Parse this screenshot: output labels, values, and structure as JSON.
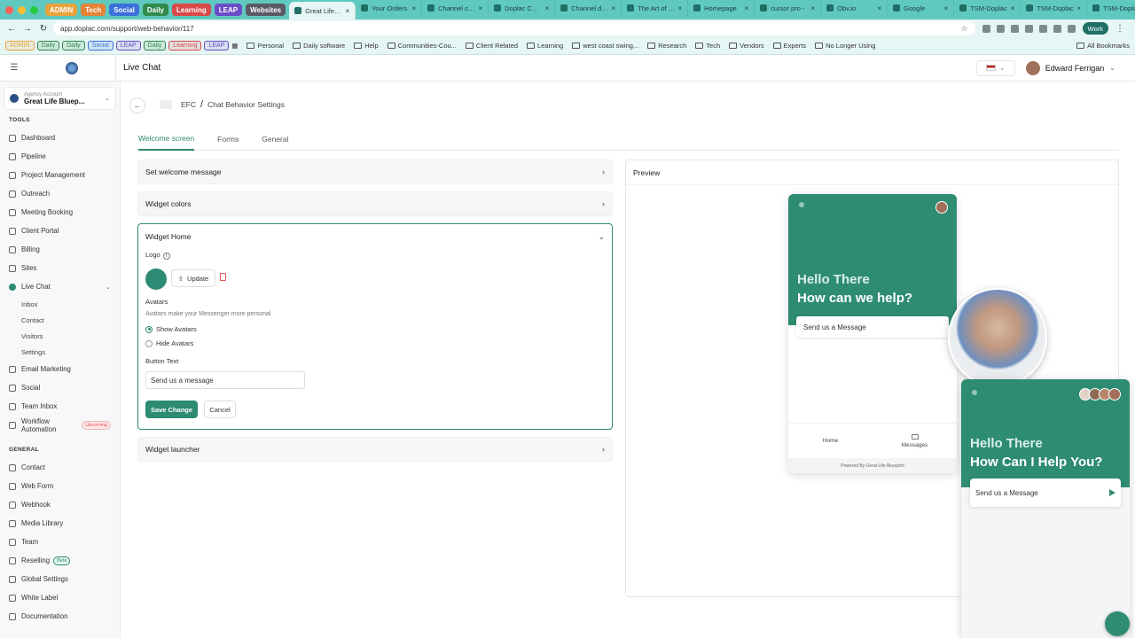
{
  "browser": {
    "tab_groups": [
      {
        "label": "ADMIN",
        "color": "#e8a33d"
      },
      {
        "label": "Tech",
        "color": "#e5823a"
      },
      {
        "label": "Social",
        "color": "#3b6fd9"
      },
      {
        "label": "Daily",
        "color": "#2f8a4b"
      },
      {
        "label": "Learning",
        "color": "#d9484b"
      },
      {
        "label": "LEAP",
        "color": "#6c4cc9"
      },
      {
        "label": "Websites",
        "color": "#5a5a66"
      }
    ],
    "tabs": [
      {
        "title": "Great Life Blue",
        "active": true
      },
      {
        "title": "Your Orders",
        "active": false
      },
      {
        "title": "Channel cont",
        "active": false
      },
      {
        "title": "Doplac CRM",
        "active": false
      },
      {
        "title": "Channel dash",
        "active": false
      },
      {
        "title": "The Art of Mu",
        "active": false
      },
      {
        "title": "Homepage",
        "active": false
      },
      {
        "title": "cursor pro -",
        "active": false
      },
      {
        "title": "Obv.io",
        "active": false
      },
      {
        "title": "Google",
        "active": false
      },
      {
        "title": "TSM-Doplac",
        "active": false
      },
      {
        "title": "TSM-Doplac",
        "active": false
      },
      {
        "title": "TSM-Doplac",
        "active": false
      }
    ],
    "url": "app.doplac.com/support/web-behavior/117",
    "profile_label": "Work",
    "bookmark_groups": [
      {
        "label": "ADMIN",
        "color": "#e8a33d"
      },
      {
        "label": "Daily",
        "color": "#2f8a4b"
      },
      {
        "label": "Daily",
        "color": "#2f8a4b"
      },
      {
        "label": "Social",
        "color": "#3b6fd9"
      },
      {
        "label": "LEAP",
        "color": "#6c4cc9"
      },
      {
        "label": "Daily",
        "color": "#2f8a4b"
      },
      {
        "label": "Learning",
        "color": "#d9484b"
      },
      {
        "label": "LEAP",
        "color": "#6c4cc9"
      }
    ],
    "bookmarks": [
      "Personal",
      "Daily software",
      "Help",
      "Communities-Cou...",
      "Client Related",
      "Learning",
      "west coast swing...",
      "Research",
      "Tech",
      "Vendors",
      "Experts",
      "No Longer Using"
    ],
    "all_bookmarks": "All Bookmarks"
  },
  "header": {
    "title": "Live Chat",
    "user_name": "Edward Ferrigan"
  },
  "sidebar": {
    "account_label": "Agency Account",
    "account_name": "Great Life Bluep...",
    "tools_label": "TOOLS",
    "tools": [
      {
        "label": "Dashboard",
        "id": "dashboard"
      },
      {
        "label": "Pipeline",
        "id": "pipeline"
      },
      {
        "label": "Project Management",
        "id": "project-management"
      },
      {
        "label": "Outreach",
        "id": "outreach"
      },
      {
        "label": "Meeting Booking",
        "id": "meeting-booking"
      },
      {
        "label": "Client Portal",
        "id": "client-portal"
      },
      {
        "label": "Billing",
        "id": "billing"
      },
      {
        "label": "Sites",
        "id": "sites"
      },
      {
        "label": "Live Chat",
        "id": "live-chat"
      }
    ],
    "livechat_sub": [
      "Inbox",
      "Contact",
      "Visitors",
      "Settings"
    ],
    "tools2": [
      {
        "label": "Email Marketing",
        "id": "email-marketing"
      },
      {
        "label": "Social",
        "id": "social"
      },
      {
        "label": "Team Inbox",
        "id": "team-inbox"
      },
      {
        "label": "Workflow Automation",
        "id": "workflow-automation",
        "badge": "Upcoming"
      }
    ],
    "general_label": "GENERAL",
    "general": [
      {
        "label": "Contact",
        "id": "contact"
      },
      {
        "label": "Web Form",
        "id": "web-form"
      },
      {
        "label": "Webhook",
        "id": "webhook"
      },
      {
        "label": "Media Library",
        "id": "media-library"
      },
      {
        "label": "Team",
        "id": "team"
      },
      {
        "label": "Reselling",
        "id": "reselling",
        "badge": "Beta"
      },
      {
        "label": "Global Settings",
        "id": "global-settings"
      },
      {
        "label": "White Label",
        "id": "white-label"
      },
      {
        "label": "Documentation",
        "id": "documentation"
      }
    ]
  },
  "breadcrumb": {
    "parent": "EFC",
    "separator": "/",
    "current": "Chat Behavior Settings"
  },
  "tabs": [
    "Welcome screen",
    "Forms",
    "General"
  ],
  "sections": {
    "welcome_message": "Set welcome message",
    "widget_colors": "Widget colors",
    "widget_home": "Widget Home",
    "widget_launcher": "Widget launcher"
  },
  "widget_home": {
    "logo_label": "Logo",
    "info_glyph": "i",
    "update_label": "Update",
    "avatars_label": "Avatars",
    "avatars_hint": "Avatars make your Messenger more personal",
    "show_avatars": "Show Avatars",
    "hide_avatars": "Hide Avatars",
    "button_text_label": "Button Text",
    "button_text_value": "Send us a message",
    "save_label": "Save Change",
    "cancel_label": "Cancel"
  },
  "preview": {
    "title": "Preview",
    "greeting": "Hello There",
    "headline": "How can we help?",
    "message": "Send us a Message",
    "nav_home": "Home",
    "nav_messages": "Messages",
    "footer": "Powered By Great Life Blueprint"
  },
  "live_widget": {
    "greeting": "Hello There",
    "headline": "How Can I Help You?",
    "message": "Send us a Message"
  },
  "colors": {
    "brand": "#2e8c72",
    "chrome": "#5fc9c0"
  }
}
